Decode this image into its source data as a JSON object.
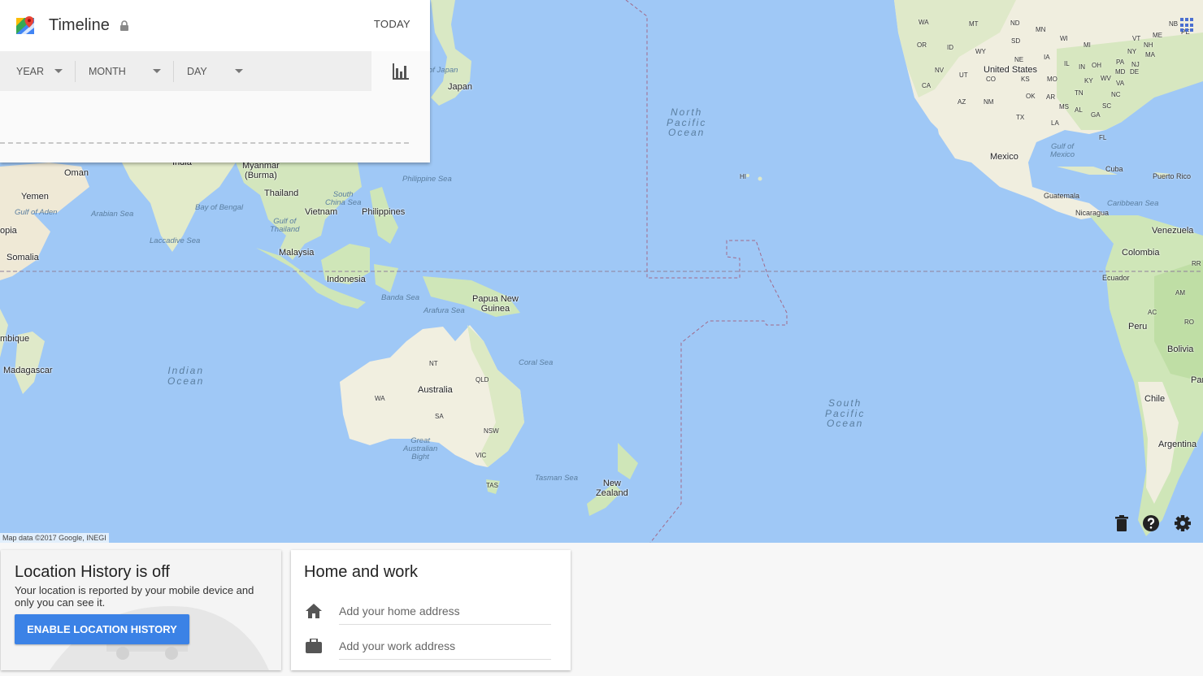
{
  "header": {
    "title": "Timeline",
    "today_label": "TODAY"
  },
  "date_selectors": [
    {
      "label": "YEAR"
    },
    {
      "label": "MONTH"
    },
    {
      "label": "DAY"
    }
  ],
  "map": {
    "attribution": "Map data ©2017 Google, INEGI",
    "labels": {
      "oman": "Oman",
      "yemen": "Yemen",
      "gulf_aden": "Gulf of Aden",
      "ethiopia": "opia",
      "somalia": "Somalia",
      "mozambique": "mbique",
      "madagascar": "Madagascar",
      "arabian_sea": "Arabian Sea",
      "laccadive": "Laccadive Sea",
      "india": "India",
      "bay_bengal": "Bay of Bengal",
      "myanmar": "Myanmar\n(Burma)",
      "thailand": "Thailand",
      "gulf_thailand": "Gulf of\nThailand",
      "vietnam": "Vietnam",
      "south_china": "South\nChina Sea",
      "philippines": "Philippines",
      "philippine_sea": "Philippine Sea",
      "malaysia": "Malaysia",
      "indonesia": "Indonesia",
      "banda_sea": "Banda Sea",
      "arafura_sea": "Arafura Sea",
      "png": "Papua New\nGuinea",
      "japan": "Japan",
      "sea_japan": "of Japan",
      "indian_ocean": "Indian\nOcean",
      "coral_sea": "Coral Sea",
      "australia": "Australia",
      "nt": "NT",
      "qld": "QLD",
      "wa": "WA",
      "sa": "SA",
      "nsw": "NSW",
      "vic": "VIC",
      "tas": "TAS",
      "great_bight": "Great\nAustralian\nBight",
      "tasman_sea": "Tasman Sea",
      "nz": "New\nZealand",
      "north_pacific": "North\nPacific\nOcean",
      "south_pacific": "South\nPacific\nOcean",
      "hi": "HI",
      "wa_us": "WA",
      "or": "OR",
      "ca": "CA",
      "id": "ID",
      "nv": "NV",
      "ut": "UT",
      "az": "AZ",
      "mt": "MT",
      "wy": "WY",
      "co": "CO",
      "nm": "NM",
      "nd": "ND",
      "sd": "SD",
      "ne": "NE",
      "ks": "KS",
      "ok": "OK",
      "tx": "TX",
      "mn": "MN",
      "ia": "IA",
      "mo": "MO",
      "ar": "AR",
      "la": "LA",
      "wi": "WI",
      "il": "IL",
      "ms": "MS",
      "mi": "MI",
      "in": "IN",
      "oh": "OH",
      "ky": "KY",
      "tn": "TN",
      "al": "AL",
      "ga": "GA",
      "fl": "FL",
      "sc": "SC",
      "nc": "NC",
      "va": "VA",
      "wv": "WV",
      "pa": "PA",
      "md": "MD",
      "de": "DE",
      "nj": "NJ",
      "ny": "NY",
      "vt": "VT",
      "nh": "NH",
      "ma": "MA",
      "me": "ME",
      "nb": "NB",
      "pe": "PE",
      "united_states": "United States",
      "mexico": "Mexico",
      "gulf_mexico": "Gulf of\nMexico",
      "cuba": "Cuba",
      "puerto_rico": "Puerto Rico",
      "guatemala": "Guatemala",
      "nicaragua": "Nicaragua",
      "caribbean": "Caribbean Sea",
      "venezuela": "Venezuela",
      "colombia": "Colombia",
      "rr": "RR",
      "ecuador": "Ecuador",
      "am": "AM",
      "peru": "Peru",
      "ac": "AC",
      "ro": "RO",
      "bolivia": "Bolivia",
      "par": "Par",
      "chile": "Chile",
      "argentina": "Argentina"
    }
  },
  "location_history": {
    "title": "Location History is off",
    "description": "Your location is reported by your mobile device and only you can see it.",
    "enable_button": "ENABLE LOCATION HISTORY"
  },
  "home_work": {
    "title": "Home and work",
    "home_placeholder": "Add your home address",
    "work_placeholder": "Add your work address"
  },
  "icons": {
    "logo": "google-maps-icon",
    "lock": "lock-icon",
    "chart": "bar-chart-icon",
    "apps": "apps-grid-icon",
    "trash": "trash-icon",
    "help": "help-icon",
    "settings": "gear-icon",
    "home": "home-icon",
    "work": "briefcase-icon"
  },
  "colors": {
    "water": "#9fc8f6",
    "land": "#f1efe4",
    "green": "#cfe6b8",
    "accent": "#3b82e6",
    "boundary": "#a06a8a"
  }
}
